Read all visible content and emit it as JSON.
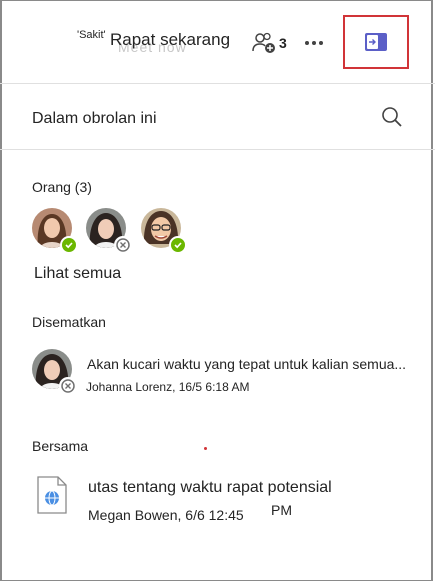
{
  "header": {
    "status_tag": "'Sakit'",
    "meet_now_label": "Rapat sekarang",
    "meet_now_ghost": "Meet now",
    "participant_count": "3"
  },
  "chat_info": {
    "title": "Dalam obrolan ini"
  },
  "people": {
    "label": "Orang (3)",
    "see_all": "Lihat semua",
    "avatars": [
      {
        "presence": "available"
      },
      {
        "presence": "offline"
      },
      {
        "presence": "available"
      }
    ]
  },
  "pinned": {
    "label": "Disematkan",
    "message": "Akan kucari waktu yang tepat untuk kalian semua...",
    "author_time": "Johanna Lorenz, 16/5 6:18 AM"
  },
  "shared": {
    "label": "Bersama",
    "file_title": "utas tentang waktu rapat potensial",
    "file_meta": "Megan Bowen, 6/6 12:45",
    "file_meta_suffix": "PM"
  },
  "colors": {
    "accent": "#5b5fc7",
    "highlight_border": "#d13438",
    "presence_available": "#6bb700"
  }
}
